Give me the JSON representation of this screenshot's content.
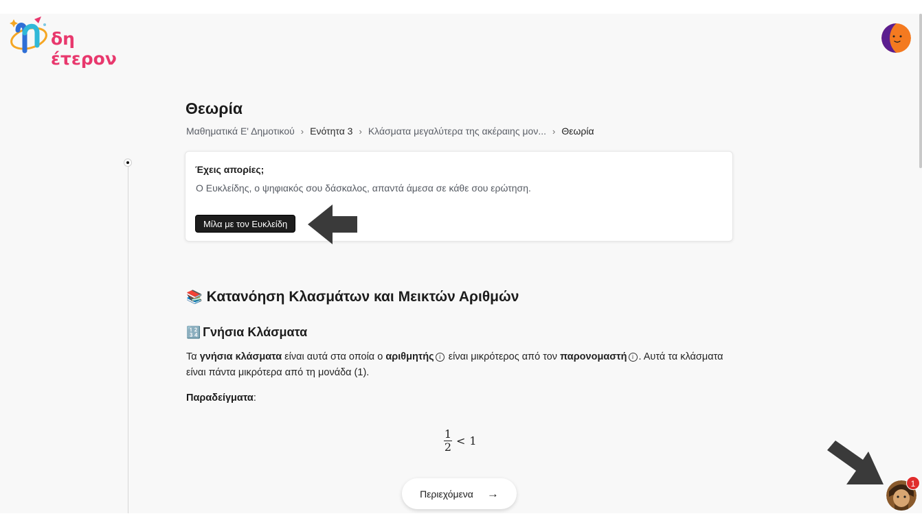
{
  "header": {
    "logo_text": "δη έτερον"
  },
  "page": {
    "title": "Θεωρία",
    "breadcrumb": [
      "Μαθηματικά Ε' Δημοτικού",
      "Ενότητα 3",
      "Κλάσματα μεγαλύτερα της ακέραιης μον...",
      "Θεωρία"
    ],
    "breadcrumb_separator": "›"
  },
  "help_card": {
    "title": "Έχεις απορίες;",
    "description": "Ο Ευκλείδης, ο ψηφιακός σου δάσκαλος, απαντά άμεσα σε κάθε σου ερώτηση.",
    "button_label": "Μίλα με τον Ευκλείδη"
  },
  "content": {
    "heading1_icon": "📚",
    "heading1": "Κατανόηση Κλασμάτων και Μεικτών Αριθμών",
    "heading2_icon": "🔢",
    "heading2": "Γνήσια Κλάσματα",
    "paragraph": {
      "p1": "Τα ",
      "b1": "γνήσια κλάσματα",
      "p2": " είναι αυτά στα οποία ο ",
      "b2": "αριθμητής",
      "p3": " είναι μικρότερος από τον ",
      "b3": "παρονομαστή",
      "p4": ". Αυτά τα κλάσματα είναι πάντα μικρότερα από τη μονάδα (1)."
    },
    "info_icon_glyph": "i",
    "examples_label": "Παραδείγματα",
    "examples_colon": ":",
    "math": {
      "numerator": "1",
      "denominator": "2",
      "relation": "<",
      "rhs": "1"
    }
  },
  "footer": {
    "contents_button": "Περιεχόμενα",
    "contents_arrow": "→"
  },
  "chat": {
    "badge_count": "1"
  },
  "colors": {
    "accent": "#e8386d",
    "badge": "#e02d2d",
    "button_dark": "#1d1d1d"
  }
}
